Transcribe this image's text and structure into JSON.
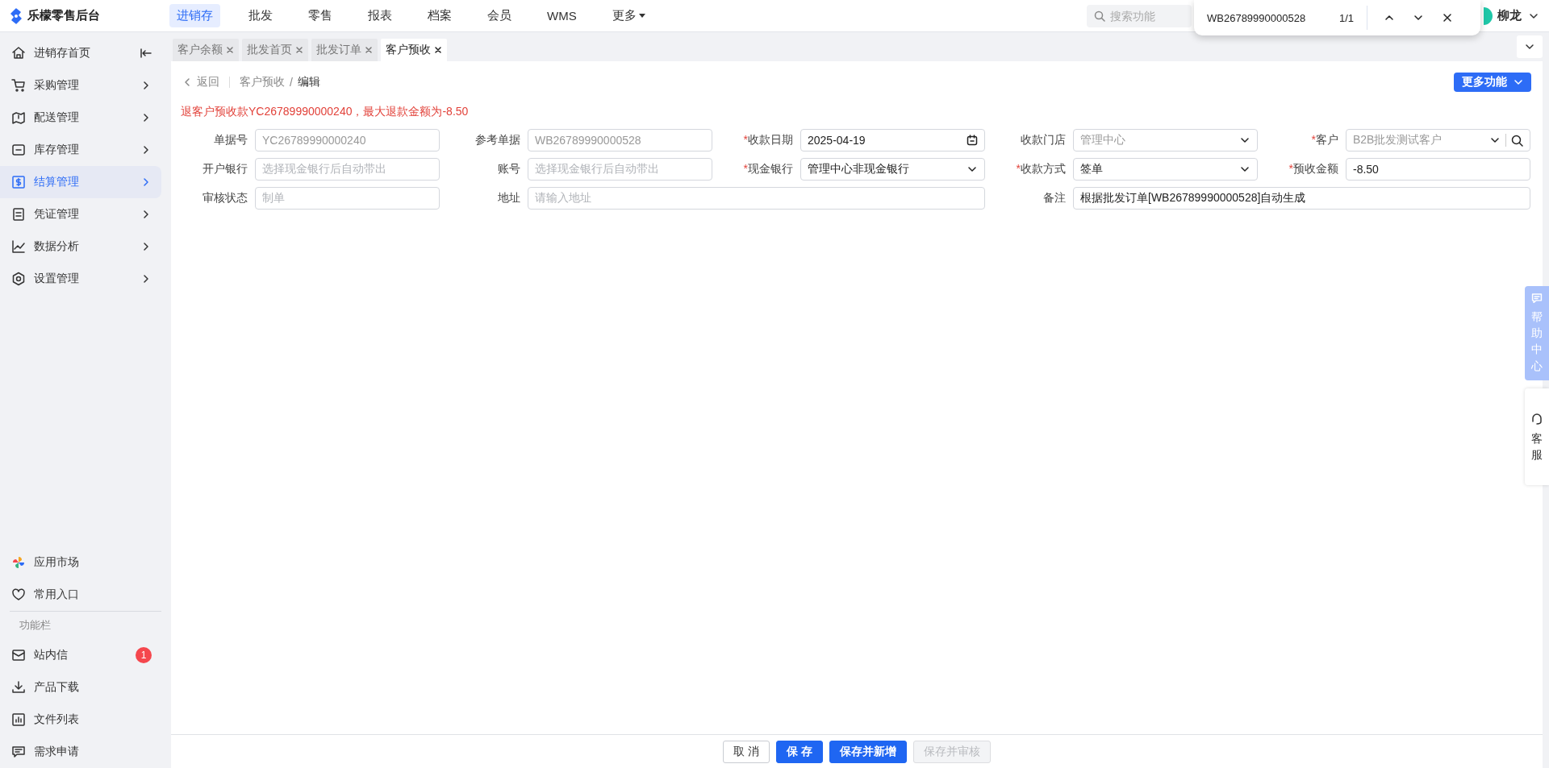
{
  "app": {
    "logo_text": "乐檬零售后台"
  },
  "top_nav": [
    {
      "label": "进销存",
      "selected": true,
      "kind": "link"
    },
    {
      "label": "批发",
      "selected": false,
      "kind": "link"
    },
    {
      "label": "零售",
      "selected": false,
      "kind": "link"
    },
    {
      "label": "报表",
      "selected": false,
      "kind": "link"
    },
    {
      "label": "档案",
      "selected": false,
      "kind": "link"
    },
    {
      "label": "会员",
      "selected": false,
      "kind": "link"
    },
    {
      "label": "WMS",
      "selected": false,
      "kind": "link"
    },
    {
      "label": "更多",
      "selected": false,
      "kind": "dropdown"
    }
  ],
  "search": {
    "placeholder": "搜索功能"
  },
  "user": {
    "name": "柳龙"
  },
  "find_bar": {
    "query": "WB26789990000528",
    "count": "1/1"
  },
  "sidebar": {
    "items": [
      {
        "label": "进销存首页",
        "kind": "pinned",
        "selected": false
      },
      {
        "label": "采购管理",
        "kind": "submenu",
        "selected": false
      },
      {
        "label": "配送管理",
        "kind": "submenu",
        "selected": false
      },
      {
        "label": "库存管理",
        "kind": "submenu",
        "selected": false
      },
      {
        "label": "结算管理",
        "kind": "submenu",
        "selected": true
      },
      {
        "label": "凭证管理",
        "kind": "submenu",
        "selected": false
      },
      {
        "label": "数据分析",
        "kind": "submenu",
        "selected": false
      },
      {
        "label": "设置管理",
        "kind": "submenu",
        "selected": false
      }
    ],
    "apps": [
      {
        "label": "应用市场"
      },
      {
        "label": "常用入口"
      }
    ],
    "section_title": "功能栏",
    "tools": [
      {
        "label": "站内信",
        "badge": "1"
      },
      {
        "label": "产品下载"
      },
      {
        "label": "文件列表"
      },
      {
        "label": "需求申请"
      }
    ]
  },
  "tabs": [
    {
      "label": "客户余额",
      "selected": false
    },
    {
      "label": "批发首页",
      "selected": false
    },
    {
      "label": "批发订单",
      "selected": false
    },
    {
      "label": "客户预收",
      "selected": true
    }
  ],
  "breadcrumb": {
    "back": "返回",
    "separator": "/",
    "path": [
      "客户预收",
      "编辑"
    ]
  },
  "more_button": "更多功能",
  "alert": "退客户预收款YC26789990000240，最大退款金额为-8.50",
  "form": {
    "required_mark": "*",
    "fields": [
      {
        "label": "单据号",
        "required": false,
        "kind": "text",
        "value": "YC26789990000240",
        "readonly": true
      },
      {
        "label": "参考单据",
        "required": false,
        "kind": "text",
        "value": "WB26789990000528",
        "readonly": true
      },
      {
        "label": "收款日期",
        "required": true,
        "kind": "date",
        "value": "2025-04-19",
        "readonly": false
      },
      {
        "label": "收款门店",
        "required": false,
        "kind": "select",
        "value": "管理中心",
        "readonly": true
      },
      {
        "label": "客户",
        "required": true,
        "kind": "lookup",
        "value": "B2B批发测试客户",
        "readonly": true
      },
      {
        "label": "开户银行",
        "required": false,
        "kind": "text",
        "placeholder": "选择现金银行后自动带出"
      },
      {
        "label": "账号",
        "required": false,
        "kind": "text",
        "placeholder": "选择现金银行后自动带出"
      },
      {
        "label": "现金银行",
        "required": true,
        "kind": "select",
        "value": "管理中心非现金银行",
        "readonly": false
      },
      {
        "label": "收款方式",
        "required": true,
        "kind": "select",
        "value": "签单",
        "readonly": false
      },
      {
        "label": "预收金额",
        "required": true,
        "kind": "text",
        "value": "-8.50",
        "readonly": false
      },
      {
        "label": "审核状态",
        "required": false,
        "kind": "text",
        "placeholder": "制单"
      },
      {
        "label": "地址",
        "required": false,
        "kind": "text",
        "placeholder": "请输入地址",
        "wide": true
      },
      {
        "label": "备注",
        "required": false,
        "kind": "text",
        "value": "根据批发订单[WB26789990000528]自动生成",
        "readonly": false,
        "wide": true
      }
    ]
  },
  "footer_buttons": [
    {
      "label": "取 消",
      "kind": "default"
    },
    {
      "label": "保 存",
      "kind": "primary"
    },
    {
      "label": "保存并新增",
      "kind": "primary"
    },
    {
      "label": "保存并审核",
      "kind": "disabled"
    }
  ],
  "side_tabs": [
    {
      "label": "帮助中心",
      "kind": "help"
    },
    {
      "label": "客服",
      "kind": "service"
    }
  ]
}
